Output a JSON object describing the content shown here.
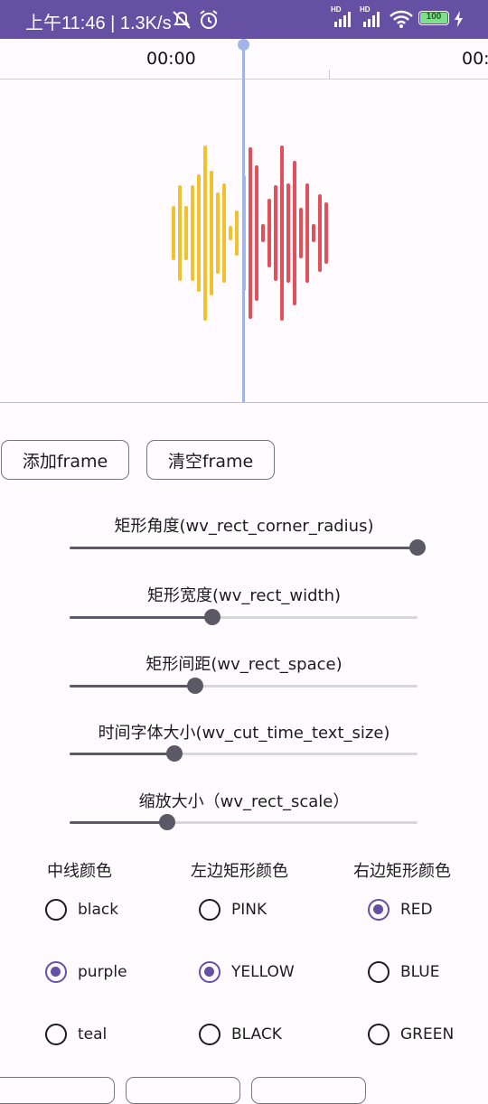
{
  "status_bar": {
    "time": "上午11:46 | 1.3K/s",
    "signal1": "HD",
    "signal2": "HD",
    "battery": "100"
  },
  "timeline": {
    "labels": [
      "00:00",
      "00:"
    ]
  },
  "waveform": {
    "left_color": "#f2c12e",
    "right_color": "#e2505a",
    "center_line_color": "#9fb5e6"
  },
  "buttons": {
    "add_frame": "添加frame",
    "clear_frame": "清空frame"
  },
  "sliders": [
    {
      "label": "矩形角度(wv_rect_corner_radius)",
      "value": 1.0
    },
    {
      "label": "矩形宽度(wv_rect_width)",
      "value": 0.41
    },
    {
      "label": "矩形间距(wv_rect_space)",
      "value": 0.36
    },
    {
      "label": "时间字体大小(wv_cut_time_text_size)",
      "value": 0.3
    },
    {
      "label": "缩放大小（wv_rect_scale）",
      "value": 0.28
    }
  ],
  "color_groups": [
    {
      "title": "中线颜色",
      "options": [
        {
          "label": "black",
          "checked": false
        },
        {
          "label": "purple",
          "checked": true
        },
        {
          "label": "teal",
          "checked": false
        }
      ]
    },
    {
      "title": "左边矩形颜色",
      "options": [
        {
          "label": "PINK",
          "checked": false
        },
        {
          "label": "YELLOW",
          "checked": true
        },
        {
          "label": "BLACK",
          "checked": false
        }
      ]
    },
    {
      "title": "右边矩形颜色",
      "options": [
        {
          "label": "RED",
          "checked": true
        },
        {
          "label": "BLUE",
          "checked": false
        },
        {
          "label": "GREEN",
          "checked": false
        }
      ]
    }
  ]
}
